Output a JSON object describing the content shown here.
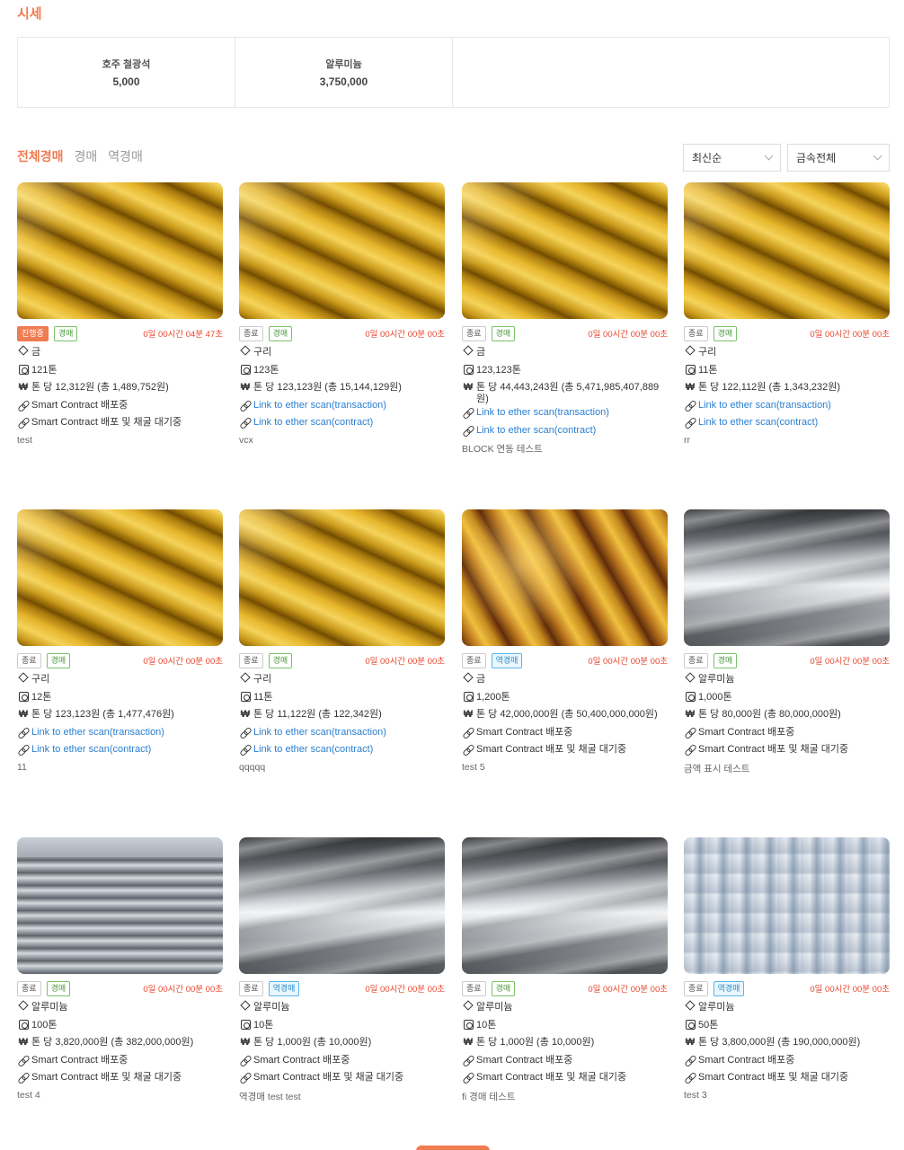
{
  "header": {
    "title": "시세"
  },
  "prices": [
    {
      "name": "호주 철광석",
      "value": "5,000"
    },
    {
      "name": "알루미늄",
      "value": "3,750,000"
    }
  ],
  "tabs": [
    {
      "label": "전체경매",
      "active": true
    },
    {
      "label": "경매",
      "active": false
    },
    {
      "label": "역경매",
      "active": false
    }
  ],
  "filters": {
    "sort": "최신순",
    "metal": "금속전체"
  },
  "cards": [
    {
      "status": "진행중",
      "type": "경매",
      "timer": "0일 00시간 04분 47초",
      "metal": "금",
      "weight": "121톤",
      "price": "톤 당 12,312원 (총 1,489,752원)",
      "line1": "Smart Contract 배포중",
      "line2": "Smart Contract 배포 및 채굴 대기중",
      "desc": "test"
    },
    {
      "status": "종료",
      "type": "경매",
      "timer": "0일 00시간 00분 00초",
      "metal": "구리",
      "weight": "123톤",
      "price": "톤 당 123,123원 (총 15,144,129원)",
      "line1": "Link to ether scan(transaction)",
      "line2": "Link to ether scan(contract)",
      "desc": "vcx"
    },
    {
      "status": "종료",
      "type": "경매",
      "timer": "0일 00시간 00분 00초",
      "metal": "금",
      "weight": "123,123톤",
      "price": "톤 당 44,443,243원 (총 5,471,985,407,889원)",
      "line1": "Link to ether scan(transaction)",
      "line2": "Link to ether scan(contract)",
      "desc": "BLOCK 연동 테스트"
    },
    {
      "status": "종료",
      "type": "경매",
      "timer": "0일 00시간 00분 00초",
      "metal": "구리",
      "weight": "11톤",
      "price": "톤 당 122,112원 (총 1,343,232원)",
      "line1": "Link to ether scan(transaction)",
      "line2": "Link to ether scan(contract)",
      "desc": "rr"
    },
    {
      "status": "종료",
      "type": "경매",
      "timer": "0일 00시간 00분 00초",
      "metal": "구리",
      "weight": "12톤",
      "price": "톤 당 123,123원 (총 1,477,476원)",
      "line1": "Link to ether scan(transaction)",
      "line2": "Link to ether scan(contract)",
      "desc": "11"
    },
    {
      "status": "종료",
      "type": "경매",
      "timer": "0일 00시간 00분 00초",
      "metal": "구리",
      "weight": "11톤",
      "price": "톤 당 11,122원 (총 122,342원)",
      "line1": "Link to ether scan(transaction)",
      "line2": "Link to ether scan(contract)",
      "desc": "qqqqq"
    },
    {
      "status": "종료",
      "type": "역경매",
      "timer": "0일 00시간 00분 00초",
      "metal": "금",
      "weight": "1,200톤",
      "price": "톤 당 42,000,000원 (총 50,400,000,000원)",
      "line1": "Smart Contract 배포중",
      "line2": "Smart Contract 배포 및 채굴 대기중",
      "desc": "test 5"
    },
    {
      "status": "종료",
      "type": "경매",
      "timer": "0일 00시간 00분 00초",
      "metal": "알루미늄",
      "weight": "1,000톤",
      "price": "톤 당 80,000원 (총 80,000,000원)",
      "line1": "Smart Contract 배포중",
      "line2": "Smart Contract 배포 및 채굴 대기중",
      "desc": "금액 표시 테스트"
    },
    {
      "status": "종료",
      "type": "경매",
      "timer": "0일 00시간 00분 00초",
      "metal": "알루미늄",
      "weight": "100톤",
      "price": "톤 당 3,820,000원 (총 382,000,000원)",
      "line1": "Smart Contract 배포중",
      "line2": "Smart Contract 배포 및 채굴 대기중",
      "desc": "test 4"
    },
    {
      "status": "종료",
      "type": "역경매",
      "timer": "0일 00시간 00분 00초",
      "metal": "알루미늄",
      "weight": "10톤",
      "price": "톤 당 1,000원 (총 10,000원)",
      "line1": "Smart Contract 배포중",
      "line2": "Smart Contract 배포 및 채굴 대기중",
      "desc": "역경매 test test"
    },
    {
      "status": "종료",
      "type": "경매",
      "timer": "0일 00시간 00분 00초",
      "metal": "알루미늄",
      "weight": "10톤",
      "price": "톤 당 1,000원 (총 10,000원)",
      "line1": "Smart Contract 배포중",
      "line2": "Smart Contract 배포 및 채굴 대기중",
      "desc": "fi 경매 테스트"
    },
    {
      "status": "종료",
      "type": "역경매",
      "timer": "0일 00시간 00분 00초",
      "metal": "알루미늄",
      "weight": "50톤",
      "price": "톤 당 3,800,000원 (총 190,000,000원)",
      "line1": "Smart Contract 배포중",
      "line2": "Smart Contract 배포 및 채굴 대기중",
      "desc": "test 3"
    }
  ],
  "icons": {
    "currency": "₩"
  }
}
